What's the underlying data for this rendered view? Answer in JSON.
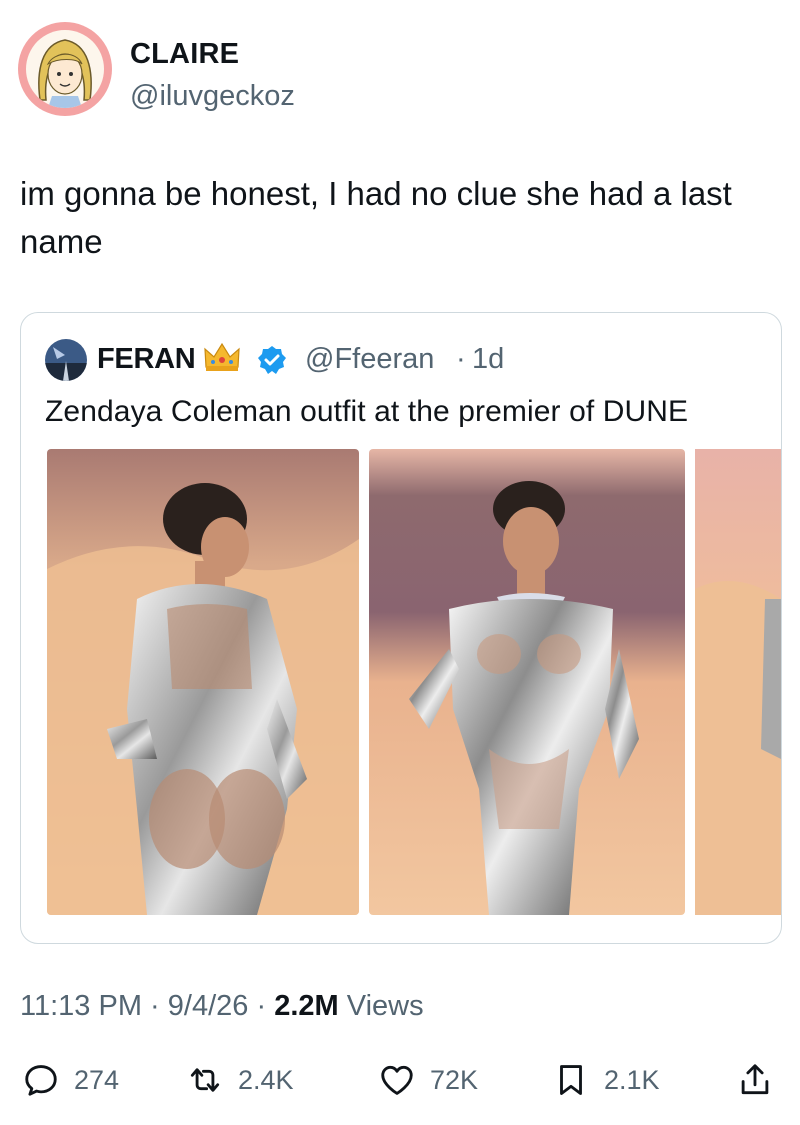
{
  "author": {
    "name": "CLAIRE",
    "handle": "@iluvgeckoz",
    "avatar_icon": "cartoon-girl-avatar",
    "avatar_ring_color": "#f4a3a3"
  },
  "tweet": {
    "text": "im gonna be honest, I had no clue she had a last name"
  },
  "quote": {
    "name": "FERAN",
    "name_emoji": "crown-icon",
    "verified_icon": "verified-badge-icon",
    "handle": "@Ffeeran",
    "separator": "·",
    "time": "1d",
    "text": "Zendaya Coleman outfit at the premier of DUNE",
    "media": [
      "photo-back-view",
      "photo-front-view",
      "photo-side-cropped"
    ]
  },
  "meta": {
    "time": "11:13 PM",
    "sep1": "·",
    "date": "9/4/26",
    "sep2": "·",
    "views_count": "2.2M",
    "views_label": "Views"
  },
  "actions": {
    "replies": "274",
    "reposts": "2.4K",
    "likes": "72K",
    "bookmarks": "2.1K"
  },
  "colors": {
    "text": "#0f1419",
    "secondary": "#536471",
    "verified": "#1d9bf0",
    "border": "#cfd9de"
  }
}
